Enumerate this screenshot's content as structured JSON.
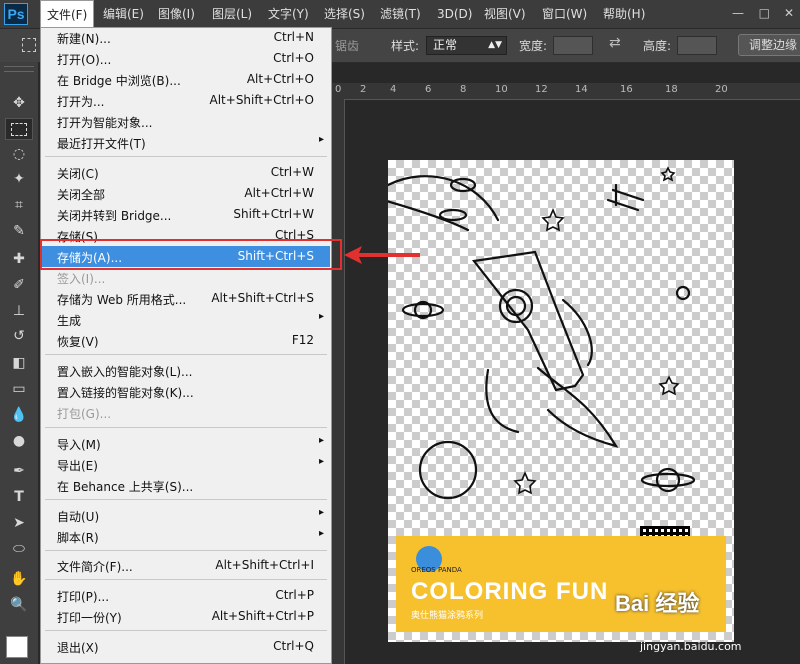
{
  "app": {
    "logo": "Ps"
  },
  "menubar": {
    "items": [
      "文件(F)",
      "编辑(E)",
      "图像(I)",
      "图层(L)",
      "文字(Y)",
      "选择(S)",
      "滤镜(T)",
      "3D(D)",
      "视图(V)",
      "窗口(W)",
      "帮助(H)"
    ],
    "window_controls": [
      "—",
      "□",
      "✕"
    ]
  },
  "options": {
    "antialias": "锯齿",
    "style_label": "样式:",
    "style_value": "正常",
    "width_label": "宽度:",
    "height_label": "高度:",
    "refine_edge": "调整边缘"
  },
  "ruler": {
    "numbers": [
      "0",
      "2",
      "4",
      "6",
      "8",
      "10",
      "12",
      "14",
      "16",
      "18",
      "20"
    ]
  },
  "file_menu": {
    "items": [
      {
        "label": "新建(N)...",
        "shortcut": "Ctrl+N"
      },
      {
        "label": "打开(O)...",
        "shortcut": "Ctrl+O"
      },
      {
        "label": "在 Bridge 中浏览(B)...",
        "shortcut": "Alt+Ctrl+O"
      },
      {
        "label": "打开为...",
        "shortcut": "Alt+Shift+Ctrl+O"
      },
      {
        "label": "打开为智能对象..."
      },
      {
        "label": "最近打开文件(T)",
        "submenu": "▸"
      },
      {
        "label": "关闭(C)",
        "shortcut": "Ctrl+W"
      },
      {
        "label": "关闭全部",
        "shortcut": "Alt+Ctrl+W"
      },
      {
        "label": "关闭并转到 Bridge...",
        "shortcut": "Shift+Ctrl+W"
      },
      {
        "label": "存储(S)",
        "shortcut": "Ctrl+S"
      },
      {
        "label": "存储为(A)...",
        "shortcut": "Shift+Ctrl+S"
      },
      {
        "label": "签入(I)..."
      },
      {
        "label": "存储为 Web 所用格式...",
        "shortcut": "Alt+Shift+Ctrl+S"
      },
      {
        "label": "生成",
        "submenu": "▸"
      },
      {
        "label": "恢复(V)",
        "shortcut": "F12"
      },
      {
        "label": "置入嵌入的智能对象(L)..."
      },
      {
        "label": "置入链接的智能对象(K)..."
      },
      {
        "label": "打包(G)..."
      },
      {
        "label": "导入(M)",
        "submenu": "▸"
      },
      {
        "label": "导出(E)",
        "submenu": "▸"
      },
      {
        "label": "在 Behance 上共享(S)..."
      },
      {
        "label": "自动(U)",
        "submenu": "▸"
      },
      {
        "label": "脚本(R)",
        "submenu": "▸"
      },
      {
        "label": "文件简介(F)...",
        "shortcut": "Alt+Shift+Ctrl+I"
      },
      {
        "label": "打印(P)...",
        "shortcut": "Ctrl+P"
      },
      {
        "label": "打印一份(Y)",
        "shortcut": "Alt+Shift+Ctrl+P"
      },
      {
        "label": "退出(X)",
        "shortcut": "Ctrl+Q"
      }
    ]
  },
  "canvas": {
    "brand": "OREOS PANDA",
    "title": "COLORING FUN",
    "subtitle": "奥仕熊猫涂鸦系列"
  },
  "watermark": {
    "main": "Bai 经验",
    "sub": "jingyan.baidu.com"
  },
  "colors": {
    "menu_highlight": "#3f8fe0",
    "annotation_red": "#e03030",
    "banner_yellow": "#f7c12e"
  }
}
